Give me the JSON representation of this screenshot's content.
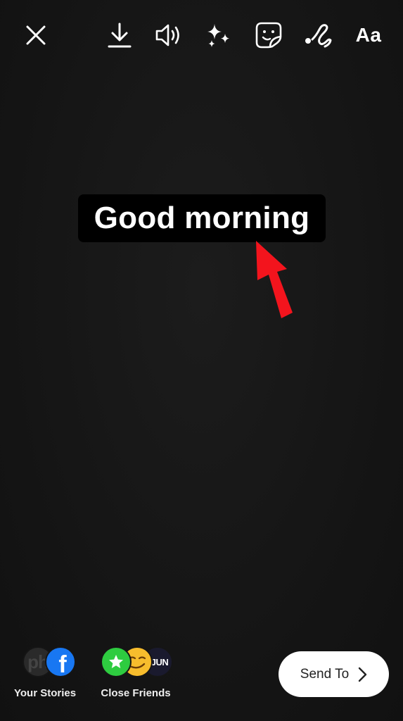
{
  "toolbar": {
    "close_icon": "close-icon",
    "download_icon": "download-icon",
    "sound_icon": "sound-icon",
    "effects_icon": "sparkles-icon",
    "sticker_icon": "sticker-icon",
    "draw_icon": "squiggle-draw-icon",
    "text_tool_label": "Aa"
  },
  "canvas": {
    "text_sticker": "Good morning",
    "annotation_arrow_color": "#f3141d",
    "background_color": "#151515"
  },
  "share": {
    "your_stories": {
      "label": "Your Stories",
      "avatar_1_text": "ph",
      "avatar_2_text": "f"
    },
    "close_friends": {
      "label": "Close Friends",
      "avatar_3_text": "JUN"
    },
    "send_to_label": "Send To",
    "close_friends_color": "#2ecc40",
    "facebook_color": "#1877f2"
  }
}
